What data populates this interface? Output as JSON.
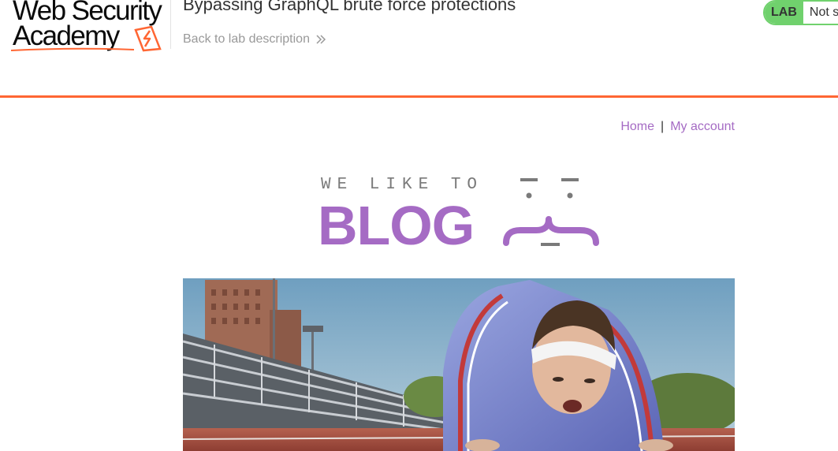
{
  "academy": {
    "logo_line1": "Web Security",
    "logo_line2": "Academy",
    "lab_title": "Bypassing GraphQL brute force protections",
    "back_link": "Back to lab description",
    "lab_badge": "LAB",
    "lab_status": "Not solved",
    "accent_color": "#ff6633",
    "status_color": "#70d16d"
  },
  "nav": {
    "home": "Home",
    "separator": "|",
    "my_account": "My account",
    "link_color": "#a56bc4"
  },
  "blog_logo": {
    "tagline": "WE LIKE TO",
    "word": "BLOG",
    "brand_color": "#a56bc4"
  },
  "hero": {
    "image_name": "runner-on-starting-line"
  },
  "icons": {
    "logo_mark": "academy-bolt-icon",
    "back_chevron": "double-chevron-right-icon",
    "blog_face": "curly-brace-face-icon"
  }
}
